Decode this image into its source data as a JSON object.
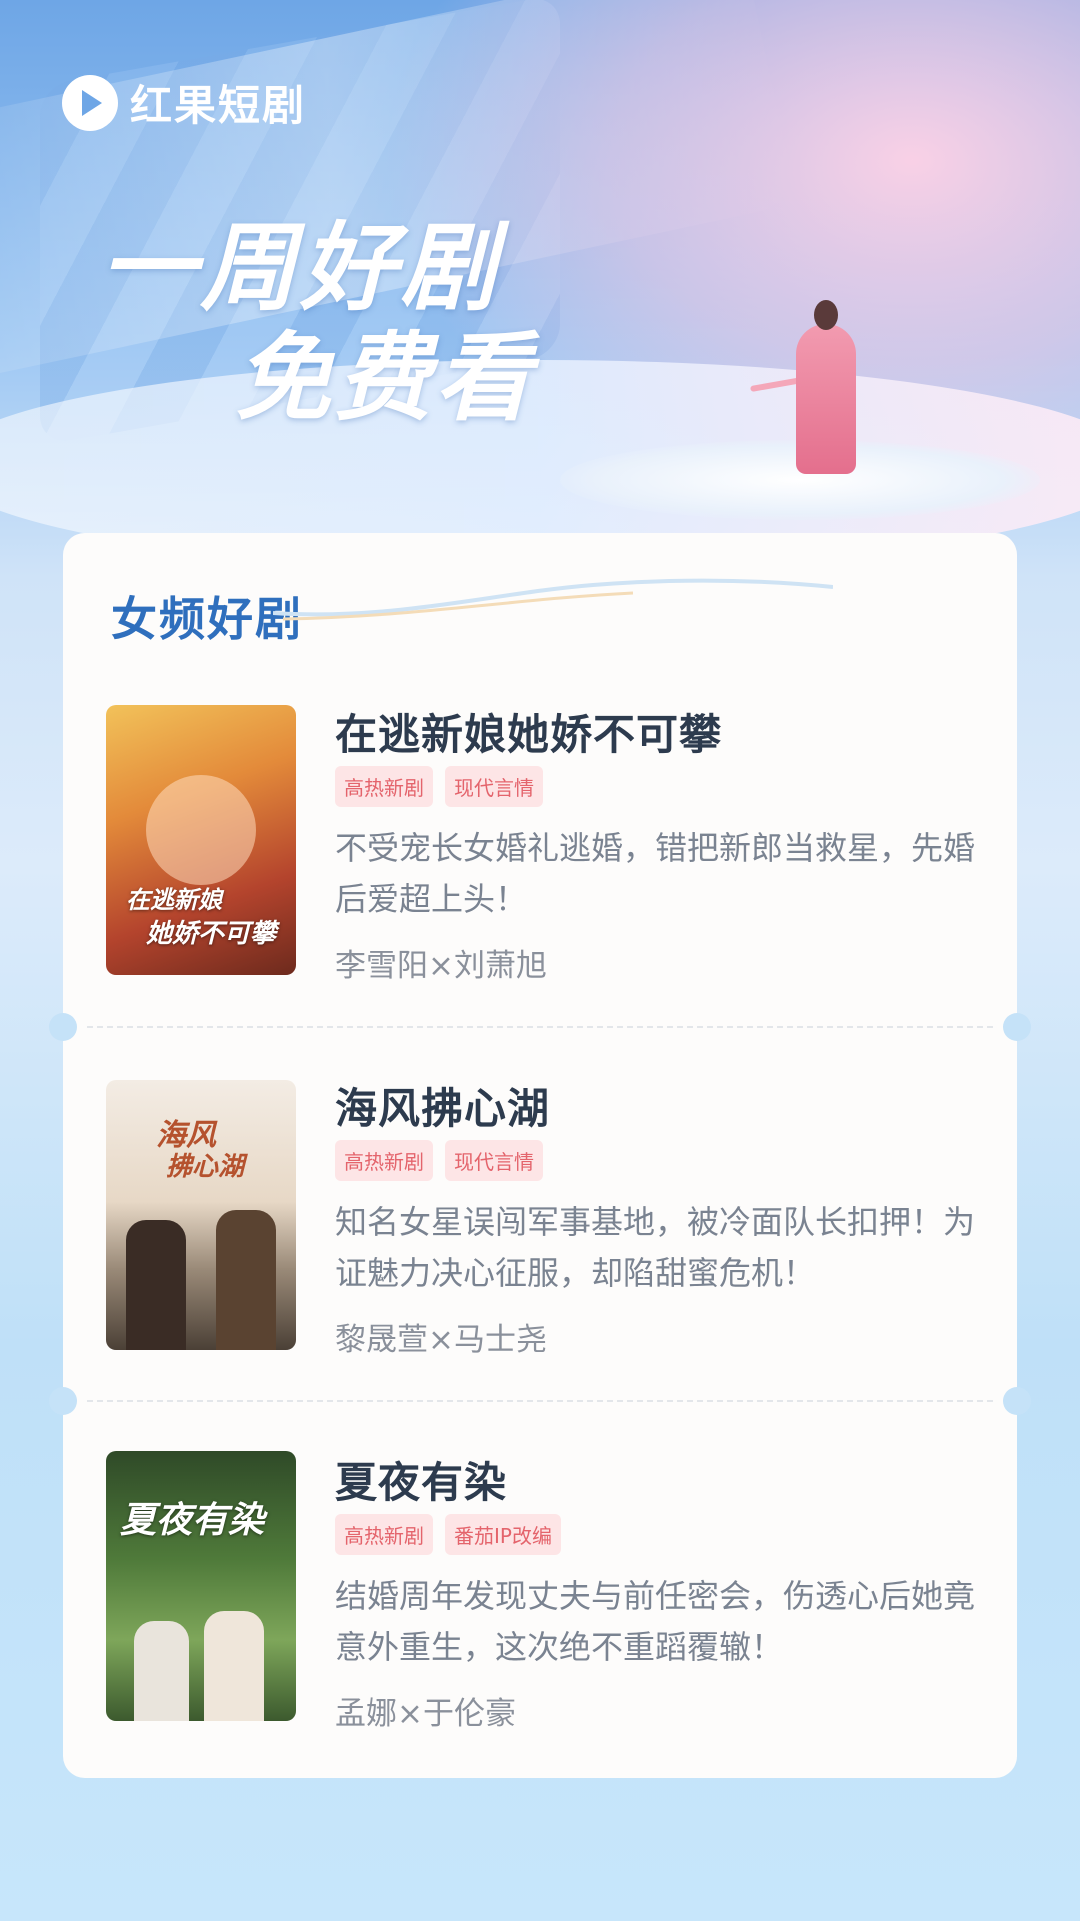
{
  "brand": {
    "name": "红果短剧"
  },
  "hero": {
    "line1": "一周好剧",
    "line2": "免费看"
  },
  "section": {
    "title": "女频好剧"
  },
  "dramas": [
    {
      "title": "在逃新娘她娇不可攀",
      "tags": [
        "高热新剧",
        "现代言情"
      ],
      "description": "不受宠长女婚礼逃婚，错把新郎当救星，先婚后爱超上头！",
      "cast": "李雪阳×刘萧旭",
      "poster_text": [
        "在逃新娘",
        "她娇不可攀"
      ]
    },
    {
      "title": "海风拂心湖",
      "tags": [
        "高热新剧",
        "现代言情"
      ],
      "description": "知名女星误闯军事基地，被冷面队长扣押！为证魅力决心征服，却陷甜蜜危机！",
      "cast": "黎晟萱×马士尧",
      "poster_text": [
        "海风",
        "拂心湖"
      ]
    },
    {
      "title": "夏夜有染",
      "tags": [
        "高热新剧",
        "番茄IP改编"
      ],
      "description": "结婚周年发现丈夫与前任密会，伤透心后她竟意外重生，这次绝不重蹈覆辙！",
      "cast": "孟娜×于伦豪",
      "poster_text": [
        "夏夜有染"
      ]
    }
  ]
}
